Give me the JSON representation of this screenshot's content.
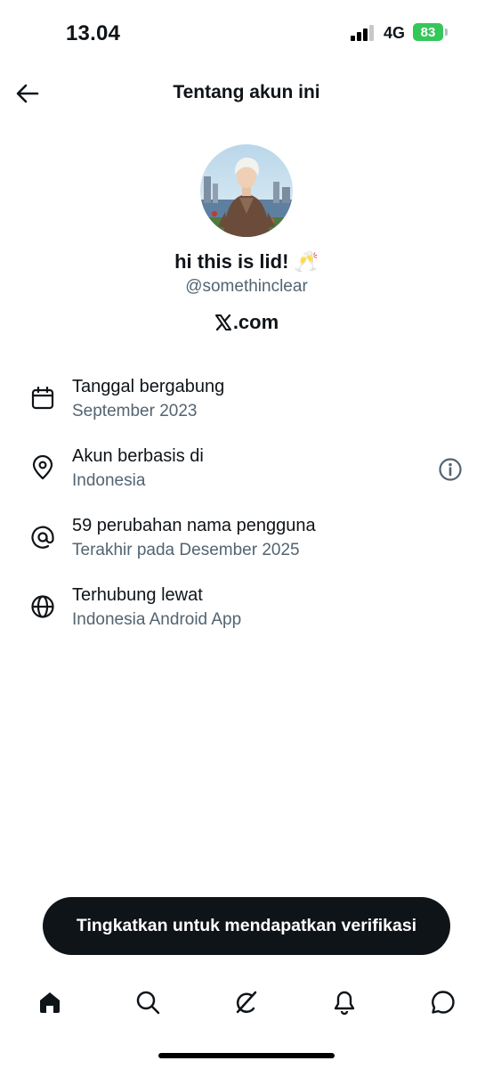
{
  "status_bar": {
    "time": "13.04",
    "network": "4G",
    "battery": "83"
  },
  "header": {
    "title": "Tentang akun ini",
    "back_icon": "arrow-left-icon"
  },
  "profile": {
    "display_name": "hi this is lid! 🥂",
    "handle": "@somethinclear",
    "verified_via": ".com"
  },
  "info_items": [
    {
      "icon": "calendar-icon",
      "title": "Tanggal bergabung",
      "subtitle": "September 2023"
    },
    {
      "icon": "location-pin-icon",
      "title": "Akun berbasis di",
      "subtitle": "Indonesia"
    },
    {
      "icon": "at-sign-icon",
      "title": "59 perubahan nama pengguna",
      "subtitle": "Terakhir pada Desember 2025"
    },
    {
      "icon": "globe-icon",
      "title": "Terhubung lewat",
      "subtitle": "Indonesia Android App"
    }
  ],
  "cta": {
    "label": "Tingkatkan untuk mendapatkan verifikasi"
  },
  "bottom_nav": [
    "home-icon",
    "search-icon",
    "grok-icon",
    "bell-icon",
    "messages-icon"
  ],
  "colors": {
    "text": "#0f1419",
    "secondary": "#536471",
    "battery": "#34c759"
  }
}
